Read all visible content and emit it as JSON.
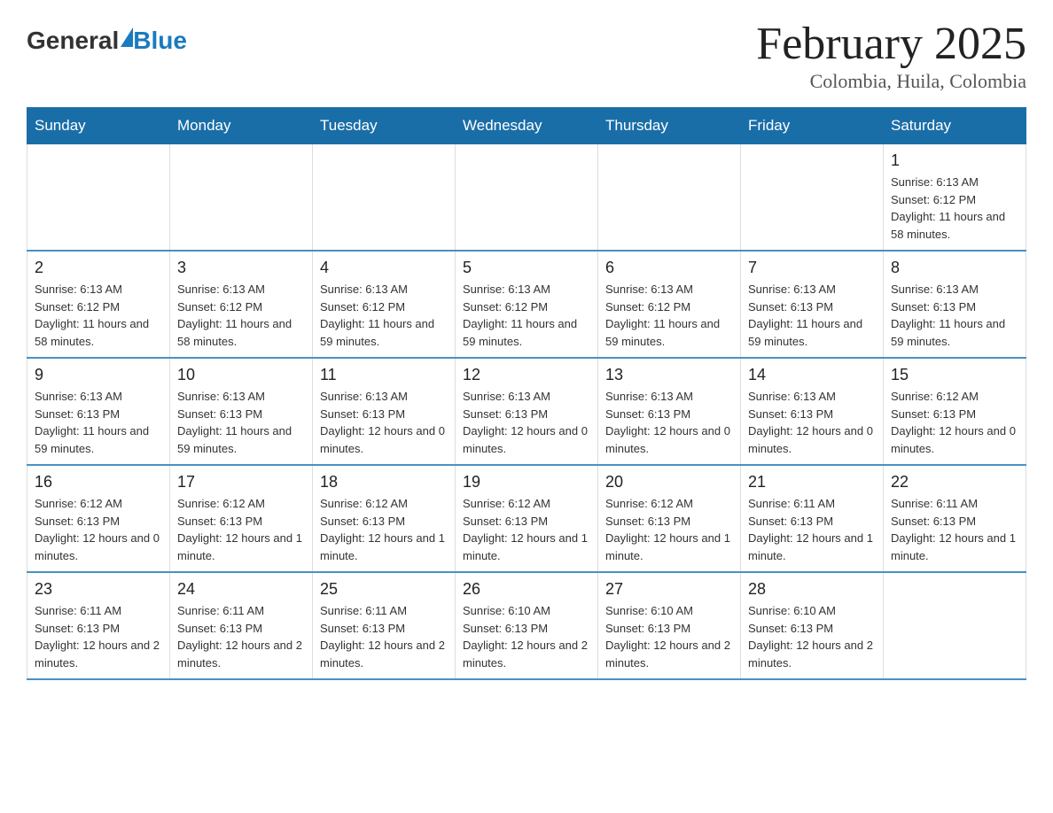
{
  "header": {
    "logo_general": "General",
    "logo_blue": "Blue",
    "title": "February 2025",
    "subtitle": "Colombia, Huila, Colombia"
  },
  "days_of_week": [
    "Sunday",
    "Monday",
    "Tuesday",
    "Wednesday",
    "Thursday",
    "Friday",
    "Saturday"
  ],
  "weeks": [
    [
      {
        "day": "",
        "info": ""
      },
      {
        "day": "",
        "info": ""
      },
      {
        "day": "",
        "info": ""
      },
      {
        "day": "",
        "info": ""
      },
      {
        "day": "",
        "info": ""
      },
      {
        "day": "",
        "info": ""
      },
      {
        "day": "1",
        "info": "Sunrise: 6:13 AM\nSunset: 6:12 PM\nDaylight: 11 hours and 58 minutes."
      }
    ],
    [
      {
        "day": "2",
        "info": "Sunrise: 6:13 AM\nSunset: 6:12 PM\nDaylight: 11 hours and 58 minutes."
      },
      {
        "day": "3",
        "info": "Sunrise: 6:13 AM\nSunset: 6:12 PM\nDaylight: 11 hours and 58 minutes."
      },
      {
        "day": "4",
        "info": "Sunrise: 6:13 AM\nSunset: 6:12 PM\nDaylight: 11 hours and 59 minutes."
      },
      {
        "day": "5",
        "info": "Sunrise: 6:13 AM\nSunset: 6:12 PM\nDaylight: 11 hours and 59 minutes."
      },
      {
        "day": "6",
        "info": "Sunrise: 6:13 AM\nSunset: 6:12 PM\nDaylight: 11 hours and 59 minutes."
      },
      {
        "day": "7",
        "info": "Sunrise: 6:13 AM\nSunset: 6:13 PM\nDaylight: 11 hours and 59 minutes."
      },
      {
        "day": "8",
        "info": "Sunrise: 6:13 AM\nSunset: 6:13 PM\nDaylight: 11 hours and 59 minutes."
      }
    ],
    [
      {
        "day": "9",
        "info": "Sunrise: 6:13 AM\nSunset: 6:13 PM\nDaylight: 11 hours and 59 minutes."
      },
      {
        "day": "10",
        "info": "Sunrise: 6:13 AM\nSunset: 6:13 PM\nDaylight: 11 hours and 59 minutes."
      },
      {
        "day": "11",
        "info": "Sunrise: 6:13 AM\nSunset: 6:13 PM\nDaylight: 12 hours and 0 minutes."
      },
      {
        "day": "12",
        "info": "Sunrise: 6:13 AM\nSunset: 6:13 PM\nDaylight: 12 hours and 0 minutes."
      },
      {
        "day": "13",
        "info": "Sunrise: 6:13 AM\nSunset: 6:13 PM\nDaylight: 12 hours and 0 minutes."
      },
      {
        "day": "14",
        "info": "Sunrise: 6:13 AM\nSunset: 6:13 PM\nDaylight: 12 hours and 0 minutes."
      },
      {
        "day": "15",
        "info": "Sunrise: 6:12 AM\nSunset: 6:13 PM\nDaylight: 12 hours and 0 minutes."
      }
    ],
    [
      {
        "day": "16",
        "info": "Sunrise: 6:12 AM\nSunset: 6:13 PM\nDaylight: 12 hours and 0 minutes."
      },
      {
        "day": "17",
        "info": "Sunrise: 6:12 AM\nSunset: 6:13 PM\nDaylight: 12 hours and 1 minute."
      },
      {
        "day": "18",
        "info": "Sunrise: 6:12 AM\nSunset: 6:13 PM\nDaylight: 12 hours and 1 minute."
      },
      {
        "day": "19",
        "info": "Sunrise: 6:12 AM\nSunset: 6:13 PM\nDaylight: 12 hours and 1 minute."
      },
      {
        "day": "20",
        "info": "Sunrise: 6:12 AM\nSunset: 6:13 PM\nDaylight: 12 hours and 1 minute."
      },
      {
        "day": "21",
        "info": "Sunrise: 6:11 AM\nSunset: 6:13 PM\nDaylight: 12 hours and 1 minute."
      },
      {
        "day": "22",
        "info": "Sunrise: 6:11 AM\nSunset: 6:13 PM\nDaylight: 12 hours and 1 minute."
      }
    ],
    [
      {
        "day": "23",
        "info": "Sunrise: 6:11 AM\nSunset: 6:13 PM\nDaylight: 12 hours and 2 minutes."
      },
      {
        "day": "24",
        "info": "Sunrise: 6:11 AM\nSunset: 6:13 PM\nDaylight: 12 hours and 2 minutes."
      },
      {
        "day": "25",
        "info": "Sunrise: 6:11 AM\nSunset: 6:13 PM\nDaylight: 12 hours and 2 minutes."
      },
      {
        "day": "26",
        "info": "Sunrise: 6:10 AM\nSunset: 6:13 PM\nDaylight: 12 hours and 2 minutes."
      },
      {
        "day": "27",
        "info": "Sunrise: 6:10 AM\nSunset: 6:13 PM\nDaylight: 12 hours and 2 minutes."
      },
      {
        "day": "28",
        "info": "Sunrise: 6:10 AM\nSunset: 6:13 PM\nDaylight: 12 hours and 2 minutes."
      },
      {
        "day": "",
        "info": ""
      }
    ]
  ]
}
